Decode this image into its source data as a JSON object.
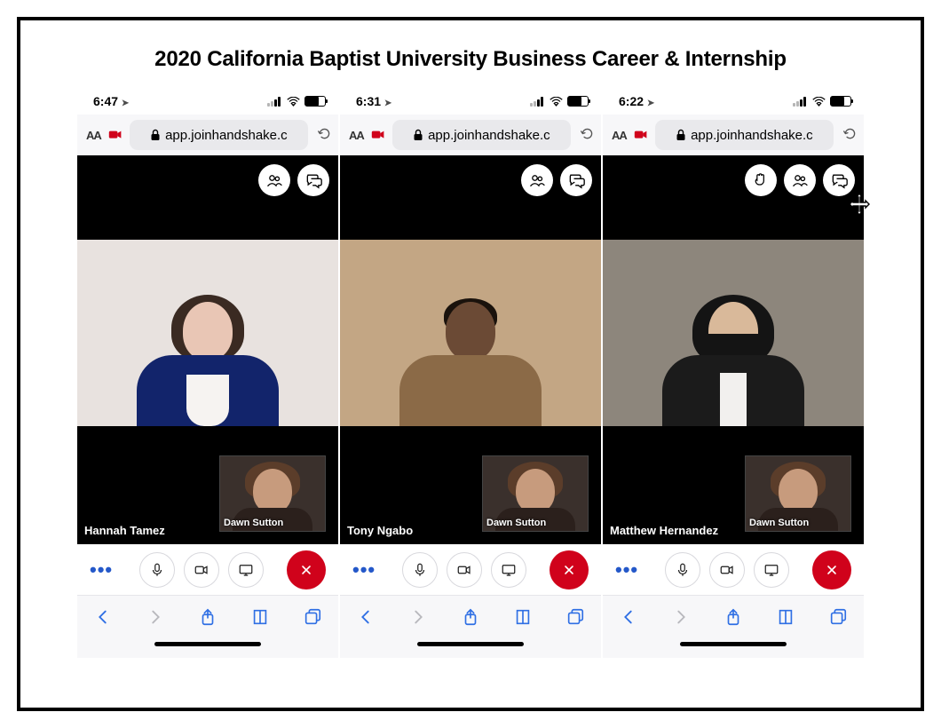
{
  "title": "2020 California Baptist University Business Career & Internship",
  "url_display": "app.joinhandshake.c",
  "phones": [
    {
      "time": "6:47",
      "main_participant": "Hannah Tamez",
      "pip_participant": "Dawn Sutton",
      "top_buttons": [
        "participants",
        "chat"
      ]
    },
    {
      "time": "6:31",
      "main_participant": "Tony Ngabo",
      "pip_participant": "Dawn Sutton",
      "top_buttons": [
        "participants",
        "chat"
      ]
    },
    {
      "time": "6:22",
      "main_participant": "Matthew Hernandez",
      "pip_participant": "Dawn Sutton",
      "top_buttons": [
        "raise-hand",
        "participants",
        "chat"
      ]
    }
  ],
  "controls": {
    "more": "•••"
  },
  "icons": {
    "aa": "AA"
  }
}
